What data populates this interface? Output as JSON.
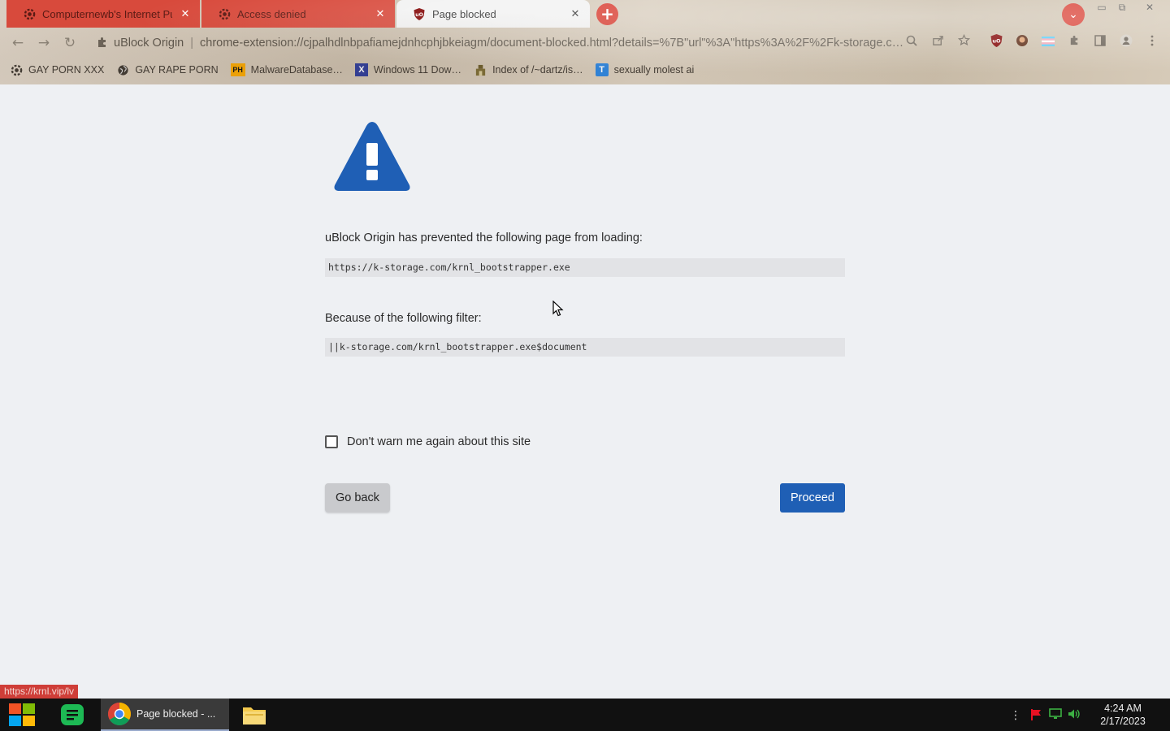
{
  "browser": {
    "tabs": [
      {
        "title": "Computernewb's Internet Pub H",
        "close": "✕",
        "state": "inactive"
      },
      {
        "title": "Access denied",
        "close": "✕",
        "state": "inactive"
      },
      {
        "title": "Page blocked",
        "close": "✕",
        "state": "active"
      }
    ],
    "new_tab": "+",
    "tab_search": "⌄",
    "window_controls": {
      "minimize": "▭",
      "restore": "⧉",
      "close": "✕"
    },
    "nav": {
      "back": "←",
      "forward": "→",
      "reload": "↻"
    },
    "omnibox": {
      "extension_name": "uBlock Origin",
      "separator": "|",
      "url": "chrome-extension://cjpalhdlnbpafiamejdnhcphjbkeiagm/document-blocked.html?details=%7B\"url\"%3A\"https%3A%2F%2Fk-storage.c…"
    },
    "bookmarks": [
      {
        "label": "GAY PORN XXX",
        "icon": "gear-icon"
      },
      {
        "label": "GAY RAPE PORN",
        "icon": "globe-icon"
      },
      {
        "label": "MalwareDatabase…",
        "icon": "ph-icon",
        "badge": "PH"
      },
      {
        "label": "Windows 11 Dow…",
        "icon": "x-icon",
        "badge": "X"
      },
      {
        "label": "Index of /~dartz/is…",
        "icon": "folder-icon"
      },
      {
        "label": "sexually molest ai",
        "icon": "translate-icon",
        "badge": "T"
      }
    ]
  },
  "blocked_page": {
    "message": "uBlock Origin has prevented the following page from loading:",
    "blocked_url": "https://k-storage.com/krnl_bootstrapper.exe",
    "filter_label": "Because of the following filter:",
    "filter": "||k-storage.com/krnl_bootstrapper.exe$document",
    "checkbox_label": "Don't warn me again about this site",
    "checkbox_checked": false,
    "go_back_label": "Go back",
    "proceed_label": "Proceed"
  },
  "status_bar": {
    "hover_url": "https://krnl.vip/lv"
  },
  "taskbar": {
    "chrome_window_title": "Page blocked - ...",
    "time": "4:24 AM",
    "date": "2/17/2023",
    "overflow": "⋮"
  },
  "colors": {
    "tab_red": "#d84a3c",
    "accent_blue": "#1f5fb5",
    "warning_blue": "#1f5fb5",
    "page_bg": "#eef0f3"
  }
}
